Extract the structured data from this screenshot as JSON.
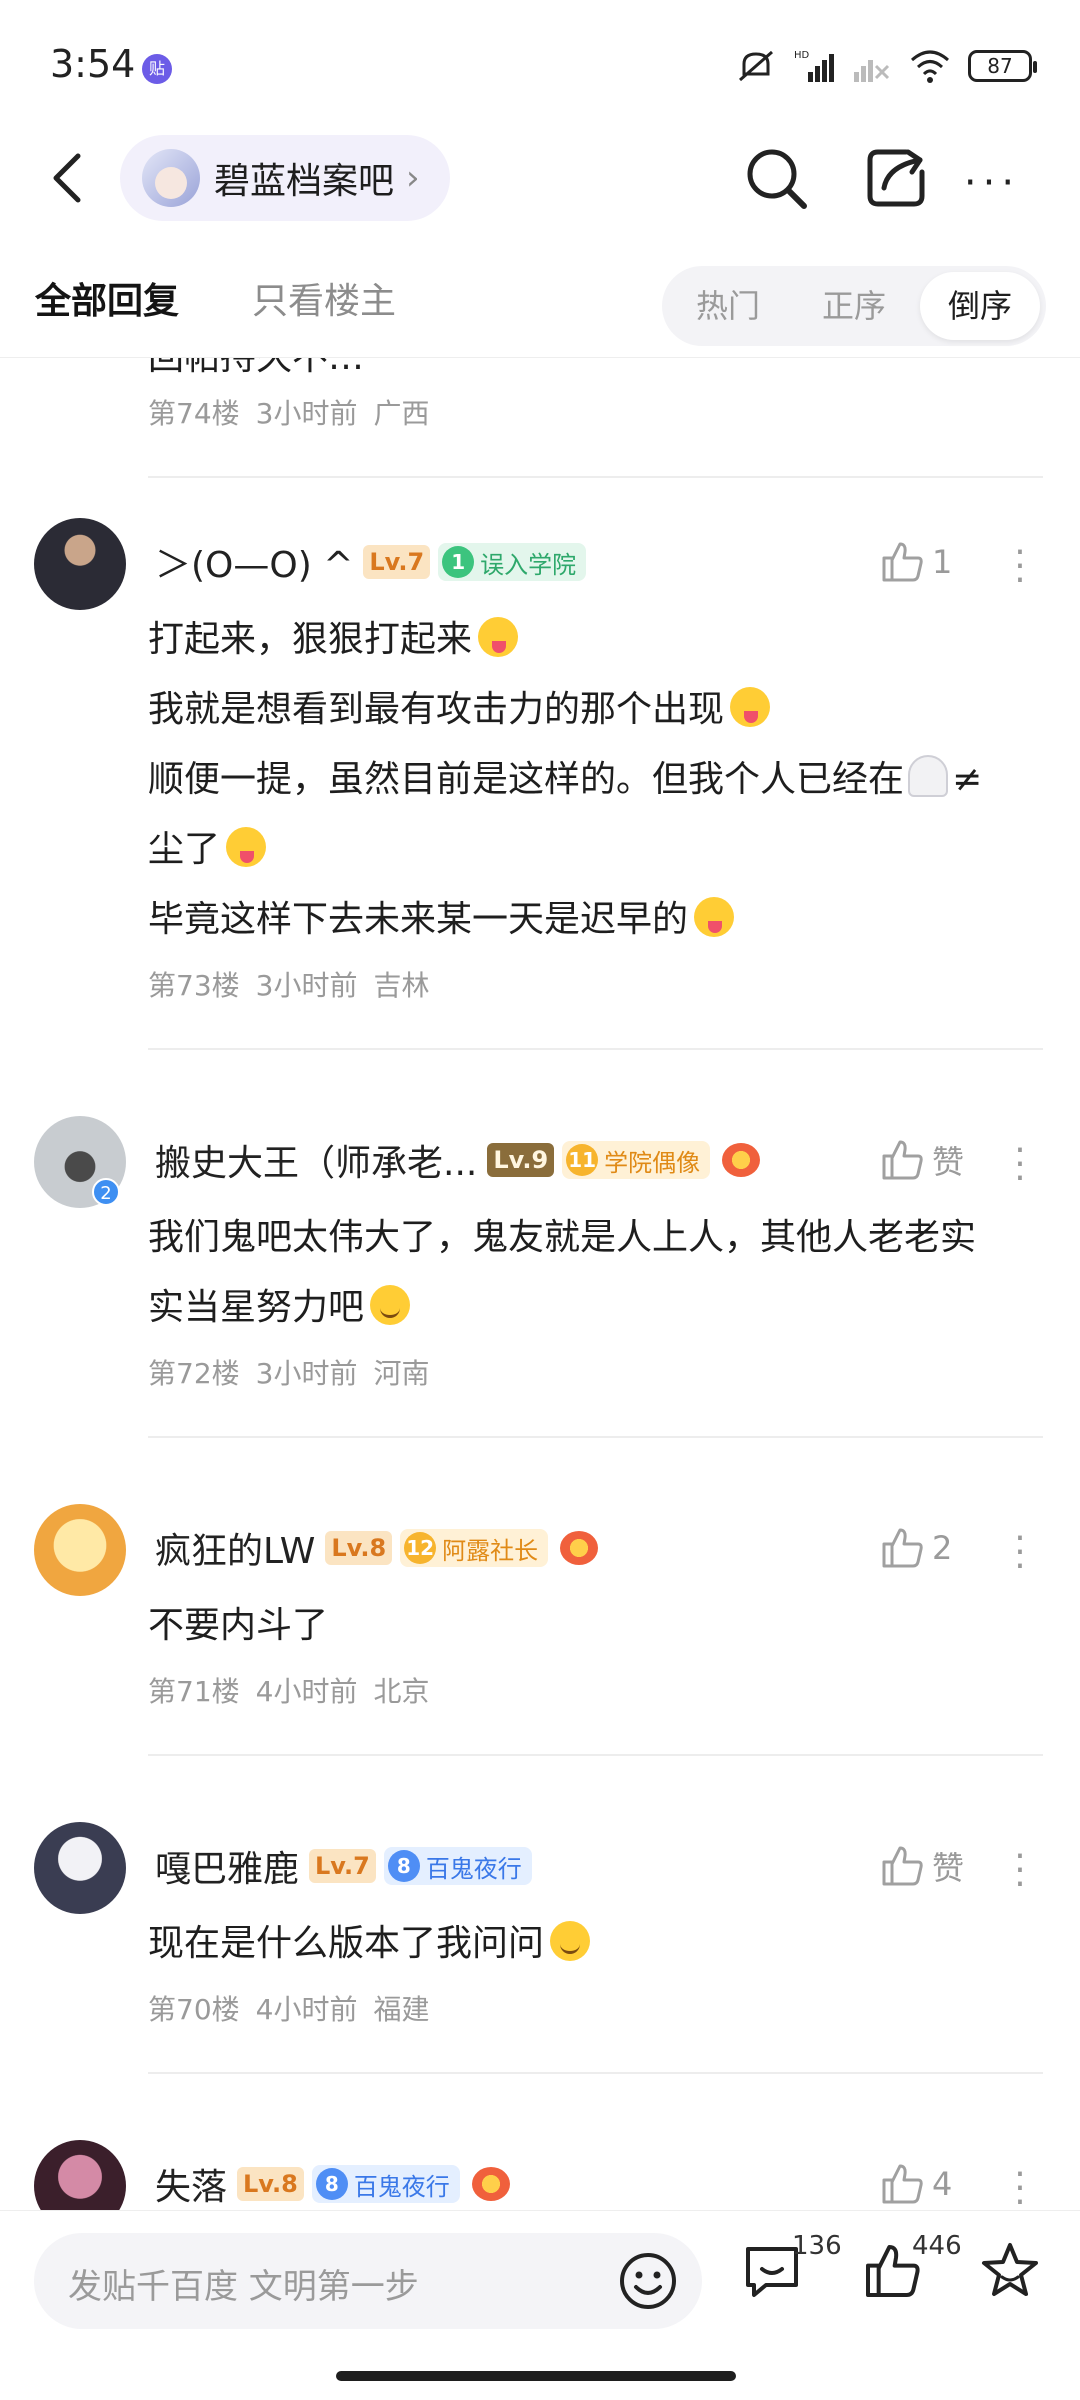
{
  "status_bar": {
    "time": "3:54",
    "app_badge": "贴",
    "battery": "87",
    "icons": [
      "mute-icon",
      "hd-signal-icon",
      "no-signal-icon",
      "wifi-icon",
      "battery-icon"
    ]
  },
  "nav": {
    "forum_name": "碧蓝档案吧",
    "icons": [
      "back-icon",
      "search-icon",
      "share-icon",
      "more-icon"
    ]
  },
  "tabs": {
    "all_replies": "全部回复",
    "op_only": "只看楼主"
  },
  "sort": {
    "hot": "热门",
    "asc": "正序",
    "desc": "倒序"
  },
  "prev_tail": {
    "text": "回帖持久不…",
    "floor": "第74楼",
    "time": "3小时前",
    "location": "广西"
  },
  "posts": [
    {
      "username": "＞(O—O) ^",
      "level": "Lv.7",
      "badge_num": "1",
      "badge_title": "误入学院",
      "likes": "1",
      "lines": [
        "打起来，狠狠打起来",
        "我就是想看到最有攻击力的那个出现",
        "顺便一提，虽然目前是这样的。但我个人已经在",
        "尘了",
        "毕竟这样下去未来某一天是迟早的"
      ],
      "line3_tail": "≠",
      "floor": "第73楼",
      "time": "3小时前",
      "location": "吉林"
    },
    {
      "username": "搬史大王（师承老...",
      "level": "Lv.9",
      "badge_num": "11",
      "badge_title": "学院偶像",
      "avatar_badge": "2",
      "likes": "赞",
      "lines": [
        "我们鬼吧太伟大了，鬼友就是人上人，其他人老老实",
        "实当星努力吧"
      ],
      "floor": "第72楼",
      "time": "3小时前",
      "location": "河南"
    },
    {
      "username": "疯狂的LW",
      "level": "Lv.8",
      "badge_num": "12",
      "badge_title": "阿露社长",
      "likes": "2",
      "lines": [
        "不要内斗了"
      ],
      "floor": "第71楼",
      "time": "4小时前",
      "location": "北京"
    },
    {
      "username": "嘎巴雅鹿",
      "level": "Lv.7",
      "badge_num": "8",
      "badge_title": "百鬼夜行",
      "likes": "赞",
      "lines": [
        "现在是什么版本了我问问"
      ],
      "floor": "第70楼",
      "time": "4小时前",
      "location": "福建"
    },
    {
      "username": "失落",
      "level": "Lv.8",
      "badge_num": "8",
      "badge_title": "百鬼夜行",
      "likes": "4"
    }
  ],
  "bottom_bar": {
    "compose_placeholder": "发贴千百度 文明第一步",
    "comment_count": "136",
    "like_count": "446"
  }
}
